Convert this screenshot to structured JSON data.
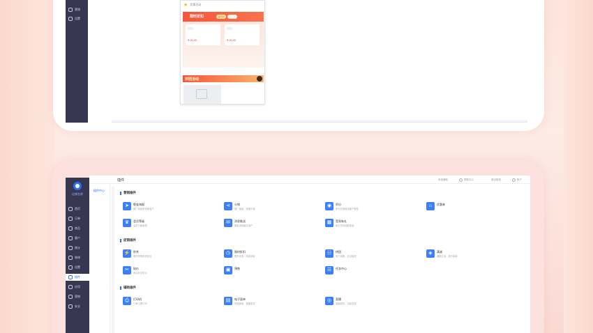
{
  "colors": {
    "accent": "#3d7ff5",
    "sidebar": "#373751",
    "promo_red": "#f6553a",
    "background_pink": "#fde1df"
  },
  "top_preview": {
    "sidebar_items": [
      {
        "label": "营销",
        "icon": "gift-icon"
      },
      {
        "label": "设置",
        "icon": "shield-icon"
      }
    ],
    "phone": {
      "title": "优惠活动",
      "banner_title": "限时折扣",
      "banner_pill": "进行中",
      "card_price_1": "¥ 00.00",
      "card_price_2": "¥ 00.00",
      "bar_title": "拼团活动",
      "image_placeholder": "image-icon"
    }
  },
  "bottom_app": {
    "brand": "店铺名称",
    "sidebar_items": [
      {
        "label": "首页",
        "icon": "home-icon"
      },
      {
        "label": "订单",
        "icon": "order-icon"
      },
      {
        "label": "商品",
        "icon": "goods-icon"
      },
      {
        "label": "客户",
        "icon": "user-icon"
      },
      {
        "label": "统计",
        "icon": "chart-icon"
      },
      {
        "label": "装修",
        "icon": "paint-icon"
      },
      {
        "label": "设置",
        "icon": "gear-icon"
      },
      {
        "label": "插件",
        "icon": "plugin-icon",
        "active": true
      },
      {
        "label": "应用",
        "icon": "grid-icon"
      },
      {
        "label": "营销",
        "icon": "gift-icon"
      },
      {
        "label": "安全",
        "icon": "shield-icon"
      }
    ],
    "sub_nav": {
      "active_label": "插件中心"
    },
    "header": {
      "title": "插件",
      "links": [
        "系统通知",
        "帮助中心",
        "退出登录",
        "账户"
      ]
    },
    "sections": [
      {
        "title": "营销插件",
        "tools": [
          {
            "name": "裂变海报",
            "desc": "推广裂变带来新客户",
            "icon": "send-icon"
          },
          {
            "name": "分销",
            "desc": "推广佣金，拓展分销",
            "icon": "share-icon"
          },
          {
            "name": "积分",
            "desc": "积分兑换增加客户黏性",
            "icon": "coin-icon"
          },
          {
            "name": "优惠券",
            "desc": "",
            "icon": "ticket-icon"
          },
          {
            "name": "会员等级",
            "desc": "会员分级管理",
            "icon": "crown-icon"
          },
          {
            "name": "消息推送",
            "desc": "模板消息触达用户",
            "icon": "message-icon"
          },
          {
            "name": "签到有礼",
            "desc": "每日签到领取奖励",
            "icon": "calendar-icon"
          }
        ]
      },
      {
        "title": "促销插件",
        "tools": [
          {
            "name": "秒杀",
            "desc": "限时抢购促进成交",
            "icon": "bolt-icon"
          },
          {
            "name": "限时折扣",
            "desc": "限时优惠，刺激消费",
            "icon": "clock-icon"
          },
          {
            "name": "拼团",
            "desc": "多人成团，社交裂变",
            "icon": "team-icon"
          },
          {
            "name": "满减",
            "desc": "满额立减，提升客单",
            "icon": "tag-icon"
          },
          {
            "name": "砍价",
            "desc": "邀请好友砍价",
            "icon": "knife-icon"
          },
          {
            "name": "预售",
            "desc": "",
            "icon": "box-icon"
          },
          {
            "name": "任务中心",
            "desc": "",
            "icon": "list-icon"
          }
        ]
      },
      {
        "title": "辅助插件",
        "tools": [
          {
            "name": "打印机",
            "desc": "订单小票打印",
            "icon": "printer-icon"
          },
          {
            "name": "电子面单",
            "desc": "快递面单，便捷发货",
            "icon": "doc-icon"
          },
          {
            "name": "直播",
            "desc": "直播带货，流量变现",
            "icon": "live-icon"
          }
        ]
      }
    ]
  }
}
